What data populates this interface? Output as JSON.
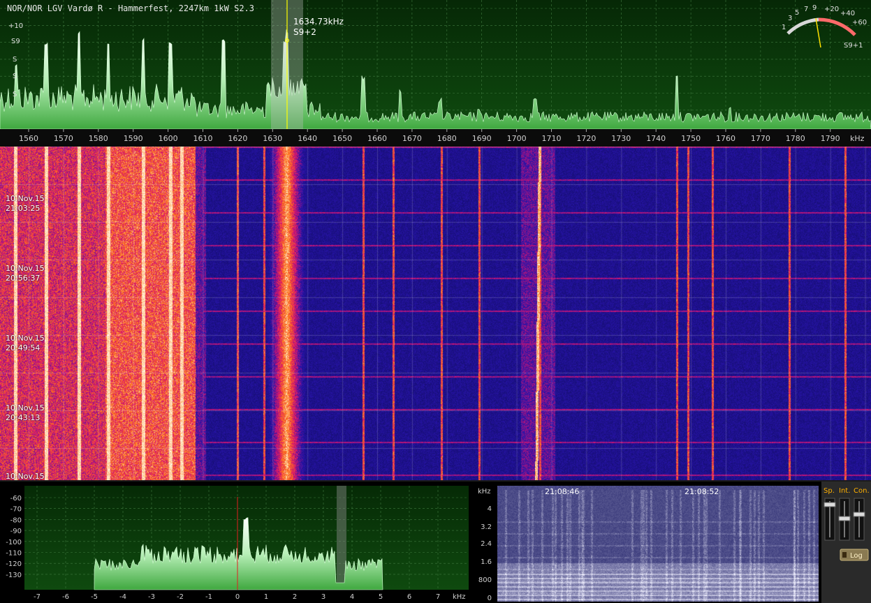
{
  "spectrum": {
    "station_info": "NOR/NOR LGV Vardø R - Hammerfest, 2247km 1kW S2.3",
    "cursor_freq": "1634.73kHz",
    "cursor_level": "S9+2",
    "y_labels": [
      "+10",
      "S9",
      "S",
      "S",
      "S"
    ],
    "freq_ticks": [
      "1560",
      "1570",
      "1580",
      "1590",
      "1600",
      "1610",
      "1620",
      "1630",
      "1640",
      "1650",
      "1660",
      "1670",
      "1680",
      "1690",
      "1700",
      "1710",
      "1720",
      "1730",
      "1740",
      "1750",
      "1760",
      "1770",
      "1780",
      "1790"
    ],
    "unit": "kHz"
  },
  "smeter": {
    "scale_labels": [
      "1",
      "3",
      "5",
      "7",
      "9",
      "+20",
      "+40",
      "+60"
    ],
    "reading": "S9+1"
  },
  "waterfall": {
    "timestamps": [
      {
        "date": "10.Nov.15",
        "time": "21:03:25"
      },
      {
        "date": "10.Nov.15",
        "time": "20:56:37"
      },
      {
        "date": "10.Nov.15",
        "time": "20:49:54"
      },
      {
        "date": "10.Nov.15",
        "time": "20:43:13"
      },
      {
        "date": "10.Nov.15",
        "time": ""
      }
    ]
  },
  "audio": {
    "y_labels": [
      "-60",
      "-70",
      "-80",
      "-90",
      "-100",
      "-110",
      "-120",
      "-130"
    ],
    "x_labels": [
      "-7",
      "-6",
      "-5",
      "-4",
      "-3",
      "-2",
      "-1",
      "0",
      "1",
      "2",
      "3",
      "4",
      "5",
      "6",
      "7"
    ],
    "unit": "kHz"
  },
  "spectrogram": {
    "unit": "kHz",
    "y_labels": [
      "4",
      "3.2",
      "2.4",
      "1.6",
      "800",
      "0"
    ],
    "times": [
      "21:08:46",
      "21:08:52"
    ]
  },
  "controls": {
    "slider_labels": [
      "Sp.",
      "Int.",
      "Con."
    ],
    "log_label": "Log"
  },
  "colors": {
    "spectrum_bg": "#0a3a0a",
    "grid": "#3f7a3f",
    "cursor": "#ffff00",
    "label_orange": "#ffb000"
  }
}
